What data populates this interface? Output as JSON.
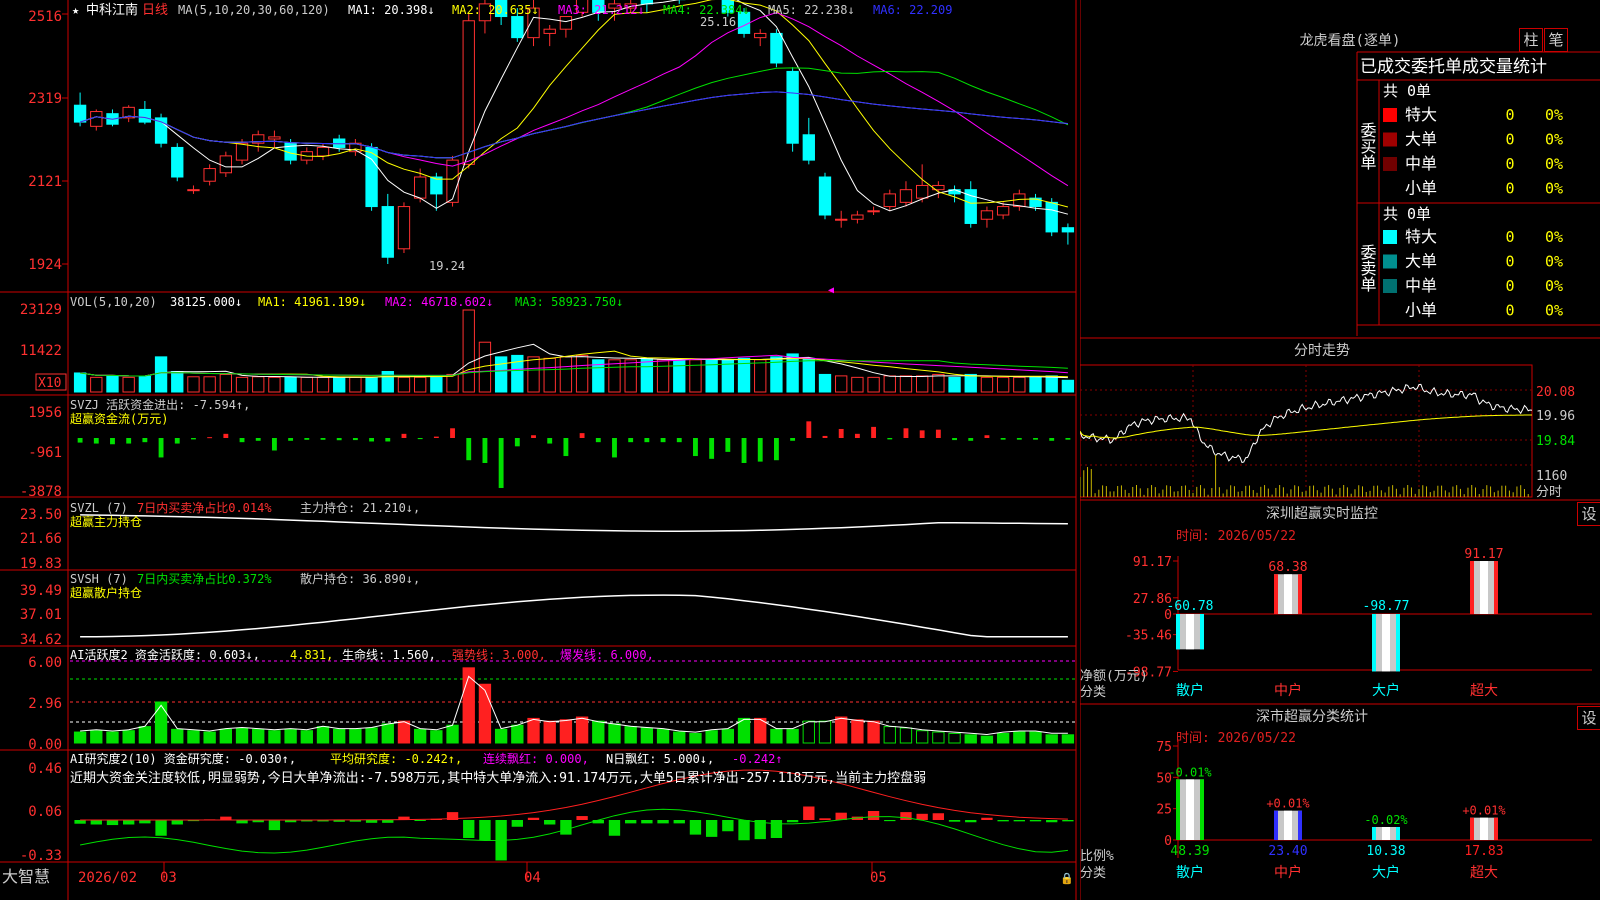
{
  "stock": {
    "star": "★",
    "name": "中科江南",
    "period": "日线"
  },
  "ma_line": {
    "label": "MA(5,10,20,30,60,120)",
    "items": [
      {
        "text": "MA1: 20.398↓",
        "color": "#ffffff"
      },
      {
        "text": "MA2: 20.635↓",
        "color": "#ffff00"
      },
      {
        "text": "MA3: 21.212↓",
        "color": "#ff00ff"
      },
      {
        "text": "MA4: 22.384↓",
        "color": "#00e000"
      },
      {
        "text": "MA5: 22.238↓",
        "color": "#c8c8c8"
      },
      {
        "text": "MA6: 22.209",
        "color": "#3030ff"
      }
    ]
  },
  "price_axis": [
    "2516",
    "2319",
    "2121",
    "1924"
  ],
  "price_high_label": "25.16",
  "price_low_label": "19.24",
  "vol": {
    "label": "VOL(5,10,20)",
    "items": [
      {
        "text": "38125.000↓",
        "color": "#ffffff"
      },
      {
        "text": "MA1: 41961.199↓",
        "color": "#ffff00"
      },
      {
        "text": "MA2: 46718.602↓",
        "color": "#ff00ff"
      },
      {
        "text": "MA3: 58923.750↓",
        "color": "#00e000"
      }
    ],
    "axis": [
      "23129",
      "11422"
    ],
    "unit": "X10"
  },
  "svzj": {
    "line1": "SVZJ  活跃资金进出: -7.594↑,",
    "line2": "超赢资金流(万元)",
    "axis": [
      "1956",
      "-961",
      "-3878"
    ]
  },
  "svzl": {
    "prefix": "SVZL (7)",
    "ratio": "7日内买卖净占比0.014%",
    "hold": "主力持仓: 21.210↓,",
    "line2": "超赢主力持仓",
    "axis": [
      "23.50",
      "21.66",
      "19.83"
    ]
  },
  "svsh": {
    "prefix": "SVSH (7)",
    "ratio": "7日内买卖净占比0.372%",
    "hold": "散户持仓: 36.890↓,",
    "line2": "超赢散户持仓",
    "axis": [
      "39.49",
      "37.01",
      "34.62"
    ]
  },
  "ai1": {
    "items": [
      {
        "text": "AI活跃度2 资金活跃度: 0.603↓,",
        "color": "#ffffff"
      },
      {
        "text": "4.831,",
        "color": "#ffff00"
      },
      {
        "text": "生命线: 1.560,",
        "color": "#ffffff"
      },
      {
        "text": "强势线: 3.000,",
        "color": "#ff3030"
      },
      {
        "text": "爆发线: 6.000,",
        "color": "#ff00ff"
      }
    ],
    "axis": [
      "6.00",
      "2.96",
      "0.00"
    ]
  },
  "ai2": {
    "items": [
      {
        "text": "AI研究度2(10) 资金研究度: -0.030↑,",
        "color": "#ffffff"
      },
      {
        "text": "平均研究度: -0.242↑,",
        "color": "#ffff00"
      },
      {
        "text": "连续飘红: 0.000,",
        "color": "#ff00ff"
      },
      {
        "text": "N日飘红: 5.000↓,",
        "color": "#ffffff"
      },
      {
        "text": "-0.242↑",
        "color": "#ff00ff"
      }
    ],
    "comment": "近期大资金关注度较低,明显弱势,今日大单净流出:-7.598万元,其中特大单净流入:91.174万元,大单5日累计净出-257.118万元,当前主力控盘弱",
    "axis": [
      "0.46",
      "0.06",
      "-0.33"
    ]
  },
  "time_axis": [
    "2026/02",
    "03",
    "04",
    "05"
  ],
  "brand": "大智慧",
  "side": {
    "title": "龙虎看盘(逐单)",
    "tab_bar": "柱",
    "tab_pen": "笔",
    "header": "已成交委托单成交量统计",
    "buy_label": "委买单",
    "sell_label": "委卖单",
    "buy_total": "共 0单",
    "sell_total": "共 0单",
    "buy_rows": [
      {
        "name": "特大",
        "count": "0",
        "pct": "0%",
        "color": "#ff0000"
      },
      {
        "name": "大单",
        "count": "0",
        "pct": "0%",
        "color": "#a00000"
      },
      {
        "name": "中单",
        "count": "0",
        "pct": "0%",
        "color": "#700000"
      },
      {
        "name": "小单",
        "count": "0",
        "pct": "0%",
        "color": "#000000"
      }
    ],
    "sell_rows": [
      {
        "name": "特大",
        "count": "0",
        "pct": "0%",
        "color": "#00ffff"
      },
      {
        "name": "大单",
        "count": "0",
        "pct": "0%",
        "color": "#009090"
      },
      {
        "name": "中单",
        "count": "0",
        "pct": "0%",
        "color": "#007070"
      },
      {
        "name": "小单",
        "count": "0",
        "pct": "0%",
        "color": "#000000"
      }
    ]
  },
  "intraday": {
    "title": "分时走势",
    "axis": [
      "20.08",
      "19.96",
      "19.84"
    ],
    "vol_label": "1160",
    "corner": "分时"
  },
  "sz_monitor": {
    "title": "深圳超赢实时监控",
    "set": "设",
    "time": "时间: 2026/05/22",
    "axis": [
      "91.17",
      "27.86",
      "0",
      "-35.46",
      "-98.77"
    ],
    "ylabel": "净额(万元)",
    "xlabel": "分类",
    "categories": [
      "散户",
      "中户",
      "大户",
      "超大"
    ],
    "values": [
      -60.78,
      68.38,
      -98.77,
      91.17
    ],
    "value_labels": [
      "-60.78",
      "68.38",
      "-98.77",
      "91.17"
    ]
  },
  "dist": {
    "title": "深市超赢分类统计",
    "set": "设",
    "time": "时间: 2026/05/22",
    "axis": [
      "75",
      "50",
      "25",
      "0"
    ],
    "ylabel": "比例%",
    "xlabel": "分类",
    "categories": [
      "散户",
      "中户",
      "大户",
      "超大"
    ],
    "values": [
      48.39,
      23.4,
      10.38,
      17.83
    ],
    "value_labels": [
      "48.39",
      "23.40",
      "10.38",
      "17.83"
    ],
    "changes": [
      "-0.01%",
      "+0.01%",
      "-0.02%",
      "+0.01%"
    ]
  },
  "chart_data": {
    "type": "candlestick",
    "title": "中科江南 日线",
    "x_ticks": [
      "2026/02",
      "03",
      "04",
      "05"
    ],
    "ohlc": [
      [
        23.0,
        23.3,
        22.5,
        22.6
      ],
      [
        22.5,
        22.9,
        22.4,
        22.85
      ],
      [
        22.8,
        22.9,
        22.5,
        22.55
      ],
      [
        22.7,
        23.0,
        22.6,
        22.95
      ],
      [
        22.9,
        23.1,
        22.55,
        22.6
      ],
      [
        22.7,
        22.8,
        22.0,
        22.1
      ],
      [
        22.0,
        22.1,
        21.2,
        21.3
      ],
      [
        21.0,
        21.1,
        20.9,
        21.0
      ],
      [
        21.2,
        21.6,
        21.1,
        21.5
      ],
      [
        21.4,
        21.9,
        21.3,
        21.8
      ],
      [
        21.7,
        22.2,
        21.6,
        22.1
      ],
      [
        22.1,
        22.4,
        21.9,
        22.3
      ],
      [
        22.2,
        22.4,
        22.0,
        22.25
      ],
      [
        22.1,
        22.2,
        21.6,
        21.7
      ],
      [
        21.7,
        22.0,
        21.6,
        21.9
      ],
      [
        21.8,
        22.1,
        21.7,
        22.0
      ],
      [
        22.2,
        22.3,
        21.9,
        22.0
      ],
      [
        21.9,
        22.2,
        21.8,
        22.1
      ],
      [
        22.0,
        22.1,
        20.5,
        20.6
      ],
      [
        20.6,
        20.9,
        19.24,
        19.4
      ],
      [
        19.6,
        20.7,
        19.5,
        20.6
      ],
      [
        20.8,
        21.5,
        20.7,
        21.3
      ],
      [
        21.3,
        21.4,
        20.5,
        20.9
      ],
      [
        20.7,
        21.8,
        20.6,
        21.7
      ],
      [
        21.6,
        25.16,
        21.5,
        25.0
      ],
      [
        25.0,
        25.6,
        24.7,
        25.4
      ],
      [
        25.5,
        25.8,
        24.9,
        25.1
      ],
      [
        25.1,
        25.3,
        24.5,
        24.6
      ],
      [
        24.6,
        25.6,
        24.4,
        25.3
      ],
      [
        24.7,
        24.9,
        24.4,
        24.8
      ],
      [
        24.8,
        25.1,
        24.6,
        25.1
      ],
      [
        25.2,
        26.0,
        25.1,
        25.6
      ],
      [
        25.6,
        25.9,
        25.0,
        25.2
      ],
      [
        25.3,
        25.6,
        25.0,
        25.4
      ],
      [
        25.3,
        25.7,
        25.2,
        25.4
      ],
      [
        25.5,
        25.7,
        25.2,
        25.4
      ],
      [
        25.6,
        25.8,
        25.5,
        25.8
      ],
      [
        25.7,
        25.9,
        25.4,
        25.5
      ],
      [
        25.6,
        26.0,
        25.6,
        25.9
      ],
      [
        25.8,
        25.9,
        25.6,
        25.7
      ],
      [
        25.6,
        25.8,
        25.1,
        25.2
      ],
      [
        25.2,
        25.3,
        24.6,
        24.7
      ],
      [
        24.6,
        24.8,
        24.4,
        24.7
      ],
      [
        24.7,
        24.8,
        23.9,
        24.0
      ],
      [
        23.8,
        23.9,
        21.9,
        22.1
      ],
      [
        22.3,
        22.7,
        21.6,
        21.7
      ],
      [
        21.3,
        21.4,
        20.3,
        20.4
      ],
      [
        20.3,
        20.5,
        20.1,
        20.3
      ],
      [
        20.3,
        20.5,
        20.2,
        20.4
      ],
      [
        20.5,
        20.6,
        20.4,
        20.5
      ],
      [
        20.6,
        21.0,
        20.5,
        20.9
      ],
      [
        20.7,
        21.2,
        20.6,
        21.0
      ],
      [
        20.8,
        21.6,
        20.7,
        21.1
      ],
      [
        21.0,
        21.2,
        20.8,
        21.1
      ],
      [
        21.0,
        21.1,
        20.7,
        20.9
      ],
      [
        21.0,
        21.2,
        20.1,
        20.2
      ],
      [
        20.3,
        20.6,
        20.1,
        20.5
      ],
      [
        20.4,
        20.7,
        20.3,
        20.6
      ],
      [
        20.6,
        21.0,
        20.5,
        20.9
      ],
      [
        20.8,
        20.9,
        20.5,
        20.6
      ],
      [
        20.7,
        20.8,
        19.9,
        20.0
      ],
      [
        20.1,
        20.2,
        19.7,
        20.0
      ]
    ],
    "volume_x10": [
      6500,
      5000,
      5500,
      5000,
      5400,
      12000,
      7000,
      5200,
      5200,
      6000,
      5000,
      5200,
      5000,
      5000,
      5000,
      5000,
      5000,
      5000,
      5000,
      7000,
      5000,
      5000,
      5500,
      6000,
      28000,
      17000,
      12000,
      12500,
      12000,
      11500,
      12000,
      12500,
      11000,
      11000,
      11000,
      11500,
      11000,
      11000,
      11000,
      11000,
      11000,
      11500,
      11000,
      12000,
      13000,
      11500,
      6000,
      5500,
      5000,
      5000,
      5500,
      5500,
      5500,
      6000,
      5000,
      6000,
      5000,
      5000,
      5000,
      5000,
      5500,
      4000
    ],
    "svzj_flow": [
      -330,
      -400,
      -450,
      -400,
      -300,
      -1400,
      -400,
      -100,
      60,
      300,
      -300,
      -200,
      -900,
      -200,
      -130,
      -130,
      -160,
      -150,
      -250,
      -250,
      300,
      -80,
      100,
      700,
      -1600,
      -1800,
      -3600,
      -600,
      200,
      -400,
      -1300,
      350,
      -300,
      -1400,
      -300,
      -300,
      -300,
      -300,
      -1300,
      -1500,
      -1000,
      -1800,
      -1700,
      -1600,
      -200,
      1200,
      150,
      650,
      300,
      800,
      -100,
      700,
      550,
      600,
      -150,
      -200,
      200,
      -120,
      -120,
      -120,
      -200,
      -120
    ],
    "ai_activity": [
      0.8,
      0.9,
      0.8,
      0.9,
      1.2,
      3.0,
      1.0,
      0.9,
      0.8,
      1.0,
      1.1,
      1.0,
      0.9,
      1.0,
      0.9,
      1.2,
      1.0,
      1.0,
      1.1,
      1.4,
      1.6,
      1.0,
      0.9,
      1.3,
      5.5,
      4.3,
      1.0,
      1.3,
      1.8,
      1.6,
      1.7,
      1.9,
      1.6,
      1.4,
      1.2,
      1.1,
      1.0,
      0.8,
      0.7,
      0.9,
      1.0,
      1.8,
      1.8,
      1.0,
      1.0,
      1.6,
      1.6,
      1.9,
      1.7,
      1.6,
      1.2,
      1.1,
      0.9,
      0.8,
      0.7,
      0.6,
      0.5,
      0.7,
      0.8,
      0.8,
      0.6,
      0.6
    ]
  }
}
